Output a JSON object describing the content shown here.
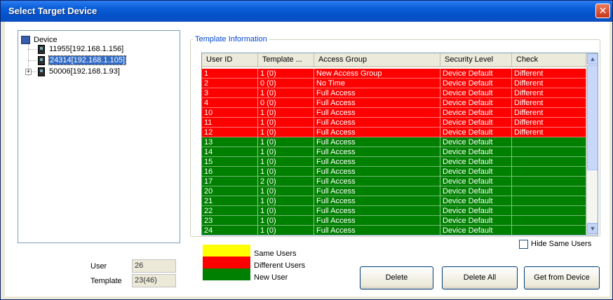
{
  "window": {
    "title": "Select Target Device",
    "close_glyph": "✕"
  },
  "tree": {
    "root_label": "Device",
    "devices": [
      {
        "label": "11955[192.168.1.156]",
        "selected": false,
        "expandable": false
      },
      {
        "label": "24314[192.168.1.105]",
        "selected": true,
        "expandable": false
      },
      {
        "label": "50006[192.168.1.93]",
        "selected": false,
        "expandable": true
      }
    ],
    "expander_glyph": "+"
  },
  "stats": {
    "user_label": "User",
    "user_value": "26",
    "template_label": "Template",
    "template_value": "23(46)"
  },
  "template_info": {
    "legend": "Template Information",
    "columns": [
      "User ID",
      "Template ...",
      "Access Group",
      "Security Level",
      "Check"
    ],
    "rows": [
      {
        "id": "1",
        "template": "1 (0)",
        "group": "New Access Group",
        "security": "Device Default",
        "check": "Different",
        "status": "red"
      },
      {
        "id": "2",
        "template": "0 (0)",
        "group": "No Time",
        "security": "Device Default",
        "check": "Different",
        "status": "red"
      },
      {
        "id": "3",
        "template": "1 (0)",
        "group": "Full Access",
        "security": "Device Default",
        "check": "Different",
        "status": "red"
      },
      {
        "id": "4",
        "template": "0 (0)",
        "group": "Full Access",
        "security": "Device Default",
        "check": "Different",
        "status": "red"
      },
      {
        "id": "10",
        "template": "1 (0)",
        "group": "Full Access",
        "security": "Device Default",
        "check": "Different",
        "status": "red"
      },
      {
        "id": "11",
        "template": "1 (0)",
        "group": "Full Access",
        "security": "Device Default",
        "check": "Different",
        "status": "red"
      },
      {
        "id": "12",
        "template": "1 (0)",
        "group": "Full Access",
        "security": "Device Default",
        "check": "Different",
        "status": "red"
      },
      {
        "id": "13",
        "template": "1 (0)",
        "group": "Full Access",
        "security": "Device Default",
        "check": "",
        "status": "green"
      },
      {
        "id": "14",
        "template": "1 (0)",
        "group": "Full Access",
        "security": "Device Default",
        "check": "",
        "status": "green"
      },
      {
        "id": "15",
        "template": "1 (0)",
        "group": "Full Access",
        "security": "Device Default",
        "check": "",
        "status": "green"
      },
      {
        "id": "16",
        "template": "1 (0)",
        "group": "Full Access",
        "security": "Device Default",
        "check": "",
        "status": "green"
      },
      {
        "id": "17",
        "template": "2 (0)",
        "group": "Full Access",
        "security": "Device Default",
        "check": "",
        "status": "green"
      },
      {
        "id": "20",
        "template": "1 (0)",
        "group": "Full Access",
        "security": "Device Default",
        "check": "",
        "status": "green"
      },
      {
        "id": "21",
        "template": "1 (0)",
        "group": "Full Access",
        "security": "Device Default",
        "check": "",
        "status": "green"
      },
      {
        "id": "22",
        "template": "1 (0)",
        "group": "Full Access",
        "security": "Device Default",
        "check": "",
        "status": "green"
      },
      {
        "id": "23",
        "template": "1 (0)",
        "group": "Full Access",
        "security": "Device Default",
        "check": "",
        "status": "green"
      },
      {
        "id": "24",
        "template": "1 (0)",
        "group": "Full Access",
        "security": "Device Default",
        "check": "",
        "status": "green"
      }
    ],
    "scroll_up_glyph": "▲",
    "scroll_down_glyph": "▼"
  },
  "hide_same": {
    "label": "Hide Same Users",
    "checked": false
  },
  "legend": [
    {
      "label": "Same Users",
      "color": "#ffff00"
    },
    {
      "label": "Different Users",
      "color": "#fe0000"
    },
    {
      "label": "New User",
      "color": "#008000"
    }
  ],
  "buttons": {
    "delete": "Delete",
    "delete_all": "Delete All",
    "get_from_device": "Get from Device"
  },
  "colors": {
    "different": "#fe0000",
    "new": "#008000",
    "same": "#ffff00",
    "titlebar": "#0451c9"
  }
}
